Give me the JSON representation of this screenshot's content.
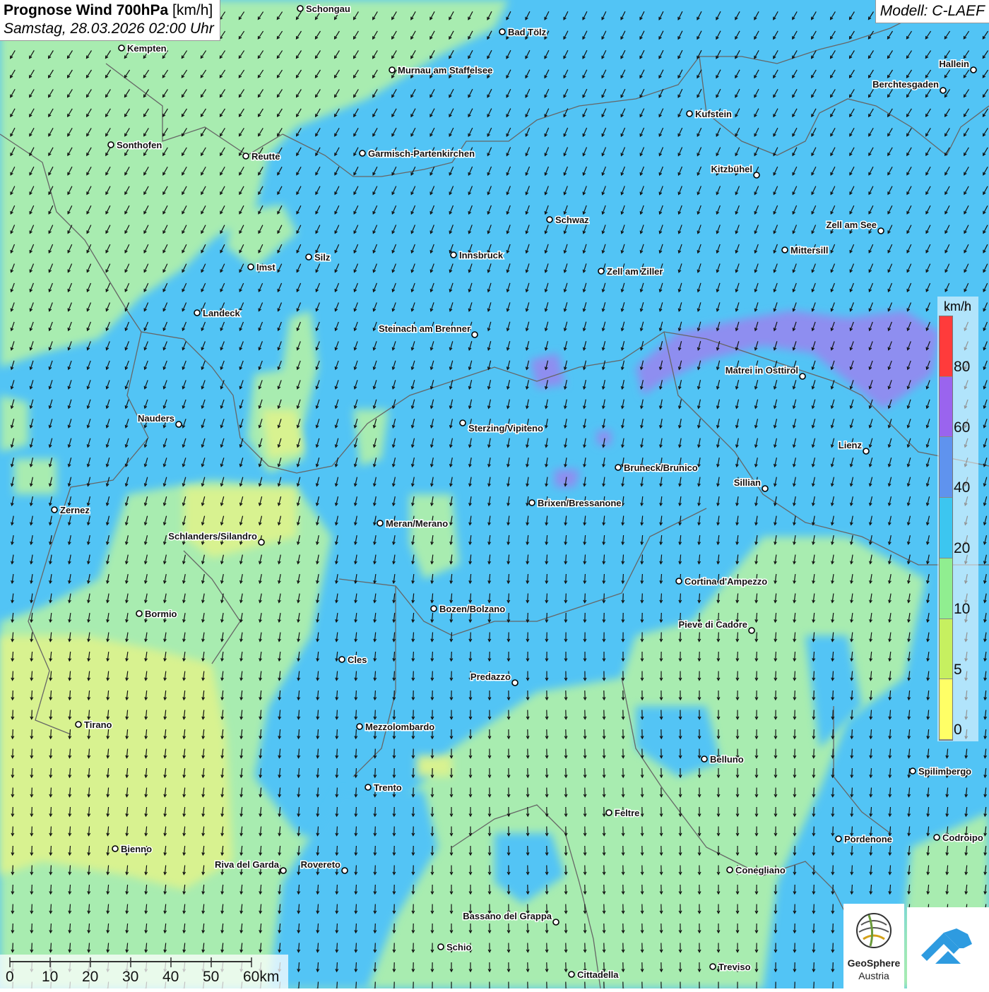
{
  "title": {
    "main": "Prognose Wind 700hPa",
    "unit": "[km/h]",
    "date": "Samstag, 28.03.2026 02:00 Uhr"
  },
  "model": "Modell: C-LAEF",
  "legend": {
    "unit": "km/h",
    "labels": [
      "80",
      "60",
      "40",
      "20",
      "10",
      "5",
      "0"
    ],
    "colors": [
      "#ff3b3b",
      "#9a64ee",
      "#5f93ee",
      "#3cc6f0",
      "#90ee90",
      "#c6f060",
      "#ffff66"
    ]
  },
  "scale": {
    "labels": [
      "0",
      "10",
      "20",
      "30",
      "40",
      "50",
      "60km"
    ]
  },
  "logos": {
    "geosphere_name": "GeoSphere",
    "geosphere_sub": "Austria"
  },
  "colors": {
    "blue_zone": "#52c4f5",
    "green_zone": "#a8ecb0",
    "yellow_zone": "#d8f290",
    "purple_zone": "#8e8ef0",
    "arrow": "#111111",
    "border": "#666666"
  },
  "cities": [
    {
      "name": "Schongau"
    },
    {
      "name": "Bad Tölz"
    },
    {
      "name": "Kempten"
    },
    {
      "name": "Murnau am Staffelsee"
    },
    {
      "name": "Hallein"
    },
    {
      "name": "Berchtesgaden"
    },
    {
      "name": "Kufstein"
    },
    {
      "name": "Sonthofen"
    },
    {
      "name": "Reutte"
    },
    {
      "name": "Garmisch-Partenkirchen"
    },
    {
      "name": "Kitzbühel"
    },
    {
      "name": "Schwaz"
    },
    {
      "name": "Zell am See"
    },
    {
      "name": "Silz"
    },
    {
      "name": "Innsbruck"
    },
    {
      "name": "Mittersill"
    },
    {
      "name": "Imst"
    },
    {
      "name": "Zell am Ziller"
    },
    {
      "name": "Landeck"
    },
    {
      "name": "Steinach am Brenner"
    },
    {
      "name": "Matrei in Osttirol"
    },
    {
      "name": "Nauders"
    },
    {
      "name": "Sterzing/Vipiteno"
    },
    {
      "name": "Lienz"
    },
    {
      "name": "Bruneck/Brunico"
    },
    {
      "name": "Sillian"
    },
    {
      "name": "Zernez"
    },
    {
      "name": "Brixen/Bressanone"
    },
    {
      "name": "Meran/Merano"
    },
    {
      "name": "Schlanders/Silandro"
    },
    {
      "name": "Cortina d'Ampezzo"
    },
    {
      "name": "Bozen/Bolzano"
    },
    {
      "name": "Bormio"
    },
    {
      "name": "Pieve di Cadore"
    },
    {
      "name": "Cles"
    },
    {
      "name": "Predazzo"
    },
    {
      "name": "Tirano"
    },
    {
      "name": "Mezzolombardo"
    },
    {
      "name": "Belluno"
    },
    {
      "name": "Spilimbergo"
    },
    {
      "name": "Trento"
    },
    {
      "name": "Feltre"
    },
    {
      "name": "Bienno"
    },
    {
      "name": "Pordenone"
    },
    {
      "name": "Codroipo"
    },
    {
      "name": "Riva del Garda"
    },
    {
      "name": "Rovereto"
    },
    {
      "name": "Conegliano"
    },
    {
      "name": "Bassano del Grappa"
    },
    {
      "name": "Schio"
    },
    {
      "name": "Treviso"
    },
    {
      "name": "Cittadella"
    }
  ]
}
